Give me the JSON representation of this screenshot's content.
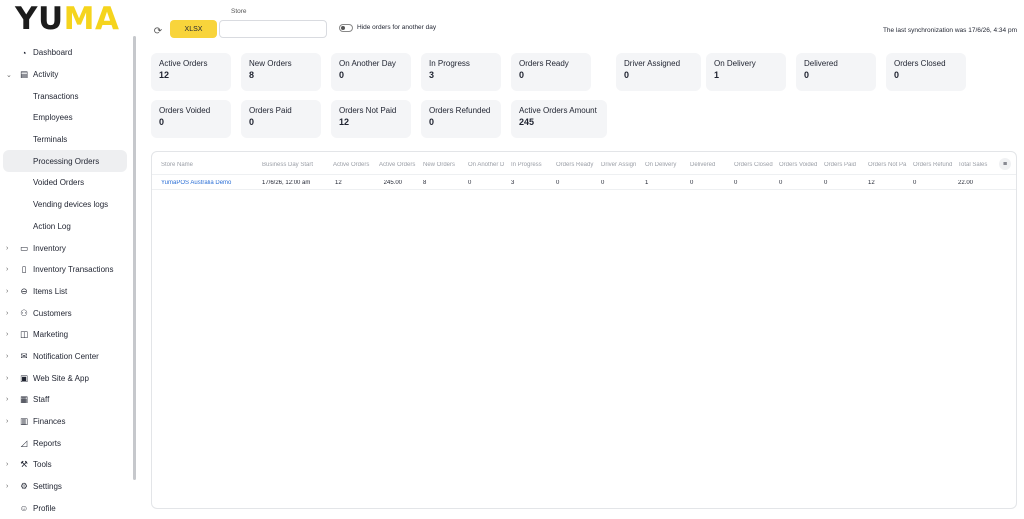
{
  "brand": {
    "logo_dark": "YU",
    "logo_accent": "MA",
    "accent_color": "#f5d41d"
  },
  "sidebar": {
    "items": [
      {
        "label": "Dashboard",
        "icon": "dashboard-icon",
        "glyph": "◔",
        "chevron": ""
      },
      {
        "label": "Activity",
        "icon": "activity-icon",
        "glyph": "▤",
        "chevron": "⌄"
      },
      {
        "label": "Transactions",
        "sub": true
      },
      {
        "label": "Employees",
        "sub": true
      },
      {
        "label": "Terminals",
        "sub": true
      },
      {
        "label": "Processing Orders",
        "sub": true,
        "active": true
      },
      {
        "label": "Voided Orders",
        "sub": true
      },
      {
        "label": "Vending devices logs",
        "sub": true
      },
      {
        "label": "Action Log",
        "sub": true
      },
      {
        "label": "Inventory",
        "icon": "inventory-icon",
        "glyph": "▭",
        "chevron": "›"
      },
      {
        "label": "Inventory Transactions",
        "icon": "inventory-transactions-icon",
        "glyph": "▯",
        "chevron": "›"
      },
      {
        "label": "Items List",
        "icon": "items-list-icon",
        "glyph": "⊖",
        "chevron": "›"
      },
      {
        "label": "Customers",
        "icon": "customers-icon",
        "glyph": "⚇",
        "chevron": "›"
      },
      {
        "label": "Marketing",
        "icon": "marketing-icon",
        "glyph": "◫",
        "chevron": "›"
      },
      {
        "label": "Notification Center",
        "icon": "notification-center-icon",
        "glyph": "✉",
        "chevron": "›"
      },
      {
        "label": "Web Site & App",
        "icon": "web-site-icon",
        "glyph": "▣",
        "chevron": "›"
      },
      {
        "label": "Staff",
        "icon": "staff-icon",
        "glyph": "▦",
        "chevron": "›"
      },
      {
        "label": "Finances",
        "icon": "finances-icon",
        "glyph": "▥",
        "chevron": "›"
      },
      {
        "label": "Reports",
        "icon": "reports-icon",
        "glyph": "◿",
        "chevron": ""
      },
      {
        "label": "Tools",
        "icon": "tools-icon",
        "glyph": "⚒",
        "chevron": "›"
      },
      {
        "label": "Settings",
        "icon": "settings-icon",
        "glyph": "⚙",
        "chevron": "›"
      },
      {
        "label": "Profile",
        "icon": "profile-icon",
        "glyph": "☺",
        "chevron": ""
      }
    ]
  },
  "toolbar": {
    "xlsx_label": "XLSX",
    "store_label": "Store",
    "store_value": "",
    "hide_orders_label": "Hide orders for another day",
    "sync_text": "The last synchronization was 17/6/26, 4:34 pm"
  },
  "cards": [
    {
      "title": "Active Orders",
      "value": "12"
    },
    {
      "title": "New Orders",
      "value": "8"
    },
    {
      "title": "On Another Day",
      "value": "0"
    },
    {
      "title": "In Progress",
      "value": "3"
    },
    {
      "title": "Orders Ready",
      "value": "0"
    },
    {
      "title": "Driver Assigned",
      "value": "0"
    },
    {
      "title": "On Delivery",
      "value": "1"
    },
    {
      "title": "Delivered",
      "value": "0"
    },
    {
      "title": "Orders Closed",
      "value": "0"
    },
    {
      "title": "Orders Voided",
      "value": "0"
    },
    {
      "title": "Orders Paid",
      "value": "0"
    },
    {
      "title": "Orders Not Paid",
      "value": "12"
    },
    {
      "title": "Orders Refunded",
      "value": "0"
    },
    {
      "title": "Active Orders Amount",
      "value": "245"
    }
  ],
  "table": {
    "columns": [
      "Store Name",
      "Business Day Start",
      "Active Orders",
      "Active Orders",
      "New Orders",
      "On Another D",
      "In Progress",
      "Orders Ready",
      "Driver Assign",
      "On Delivery",
      "Delivered",
      "Orders Closed",
      "Orders Voided",
      "Orders Paid",
      "Orders Not Pa",
      "Orders Refund",
      "Total Sales"
    ],
    "rows": [
      [
        "YumaPOS Australia Demo",
        "17/6/26, 12:00 am",
        "12",
        "245.00",
        "8",
        "0",
        "3",
        "0",
        "0",
        "1",
        "0",
        "0",
        "0",
        "0",
        "12",
        "0",
        "22.00"
      ]
    ]
  }
}
